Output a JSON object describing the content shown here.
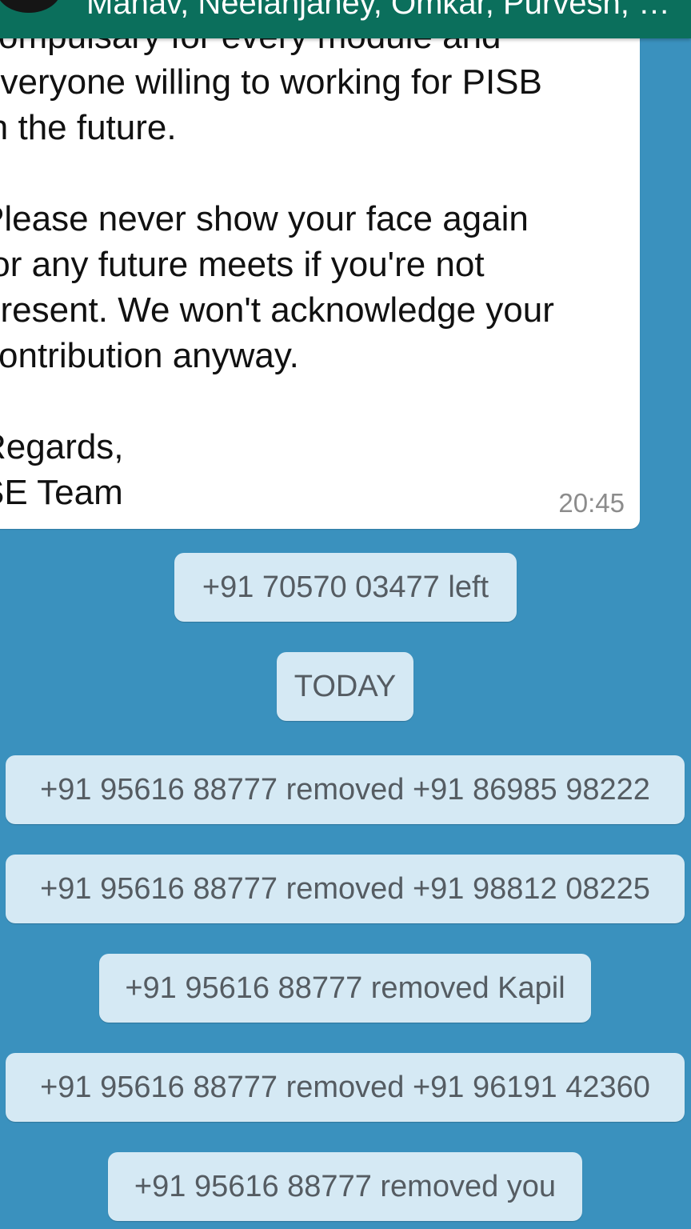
{
  "header": {
    "participants": "Manav, Neelanjaney, Omkar, Purvesh, Shr..."
  },
  "message": {
    "lines": [
      "compulsary for every module and",
      "everyone willing to working for PISB",
      "in the future.",
      "",
      "Please never show your face again",
      "for any future meets if you're not",
      "present. We won't acknowledge your",
      "contribution anyway.",
      "",
      "Regards,",
      "SE Team"
    ],
    "time": "20:45"
  },
  "events": [
    "+91 70570 03477 left",
    "TODAY",
    "+91 95616 88777 removed +91 86985 98222",
    "+91 95616 88777 removed +91 98812 08225",
    "+91 95616 88777 removed Kapil",
    "+91 95616 88777 removed +91 96191 42360",
    "+91 95616 88777 removed you"
  ],
  "colors": {
    "chat_background": "#3a91be",
    "header_background": "#0b6f5c",
    "bubble_background": "#ffffff",
    "chip_background": "#d5e9f4",
    "chip_text": "#555c62"
  }
}
